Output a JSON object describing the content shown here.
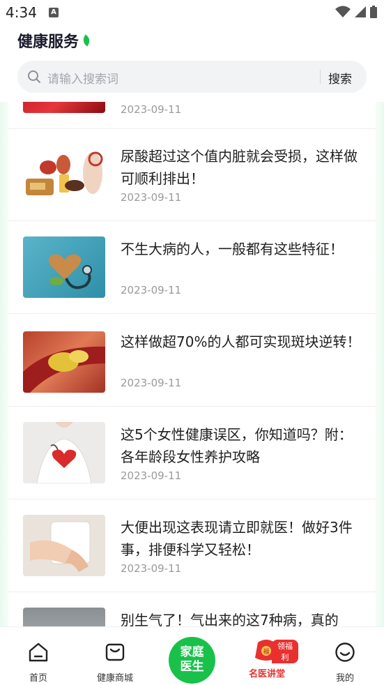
{
  "status": {
    "time": "4:34",
    "badge": "A"
  },
  "header": {
    "title": "健康服务"
  },
  "search": {
    "placeholder": "请输入搜索词",
    "button": "搜索"
  },
  "articles": [
    {
      "title": "",
      "date": "2023-09-11",
      "image": "blood-cells-image"
    },
    {
      "title": "尿酸超过这个值内脏就会受损，这样做可顺利排出！",
      "date": "2023-09-11",
      "image": "food-organs-image"
    },
    {
      "title": "不生大病的人，一般都有这些特征！",
      "date": "2023-09-11",
      "image": "heart-stethoscope-image"
    },
    {
      "title": "这样做超70%的人都可实现斑块逆转！",
      "date": "2023-09-11",
      "image": "artery-plaque-image"
    },
    {
      "title": "这5个女性健康误区，你知道吗？附：各年龄段女性养护攻略",
      "date": "2023-09-11",
      "image": "doctor-heart-image"
    },
    {
      "title": "大便出现这表现请立即就医！做好3件事，排便科学又轻松！",
      "date": "2023-09-11",
      "image": "toilet-paper-image"
    },
    {
      "title": "别生气了！气出来的这7种病，真的",
      "date": "",
      "image": "doctor-image"
    }
  ],
  "tabbar": {
    "home": "首页",
    "mall": "健康商城",
    "center_line1": "家庭",
    "center_line2": "医生",
    "lecture": "名医讲堂",
    "lecture_badge": "领福利",
    "lecture_bag": "福",
    "mine": "我的"
  },
  "colors": {
    "accent": "#19c14b",
    "lecture": "#e8312f"
  }
}
